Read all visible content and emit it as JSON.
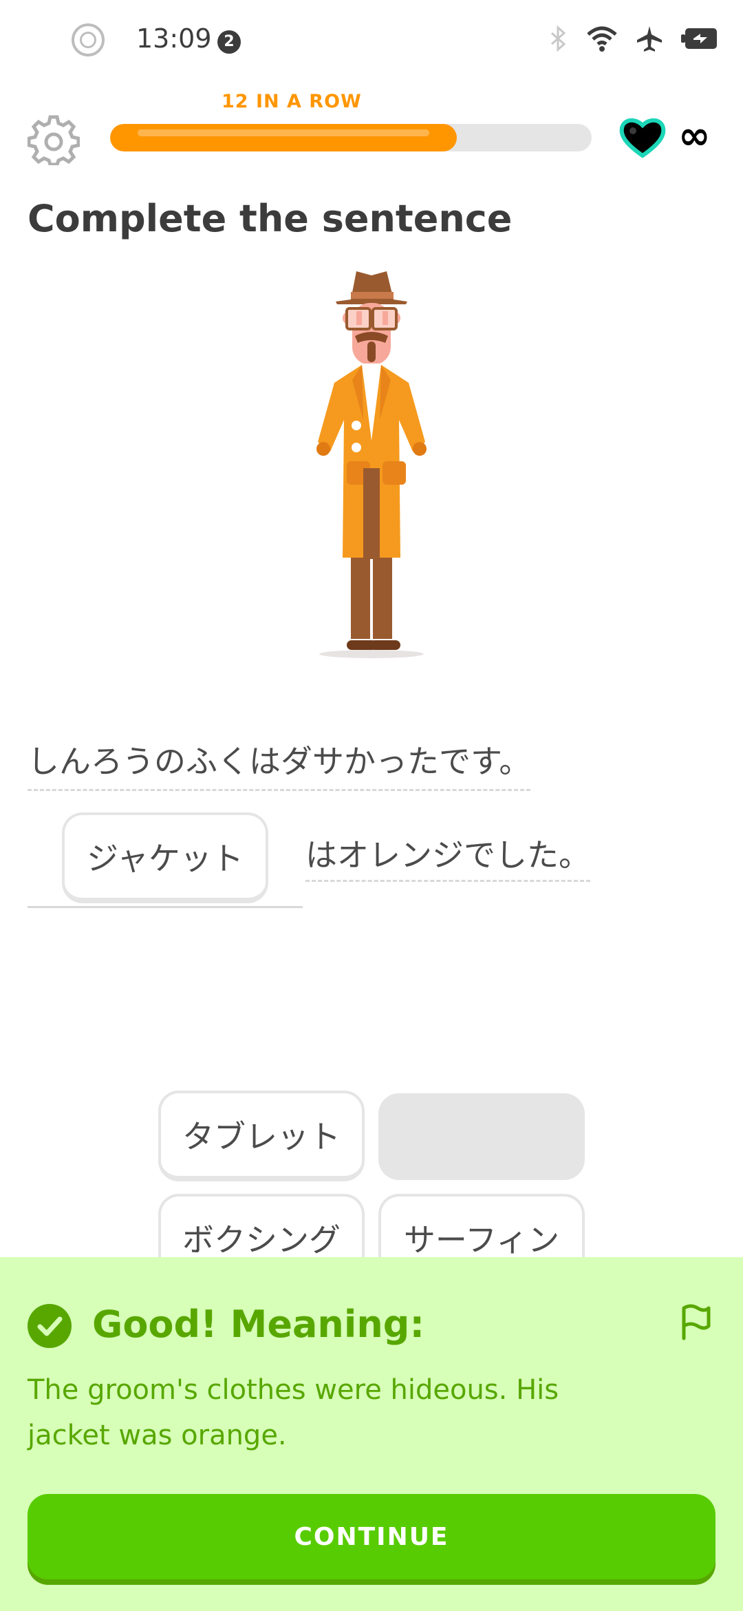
{
  "status_bar": {
    "time": "13:09",
    "notification_count": "2",
    "icons": [
      "record-icon",
      "bluetooth-icon",
      "wifi-icon",
      "airplane-icon",
      "battery-icon"
    ]
  },
  "header": {
    "streak_label": "12 IN A ROW",
    "progress": 0.72,
    "hearts": "∞"
  },
  "prompt": {
    "title": "Complete the sentence"
  },
  "exercise": {
    "sentence1": "しんろうのふくはダサかったです。",
    "answer": "ジャケット",
    "sentence2_rest": "はオレンジでした。"
  },
  "word_bank": [
    {
      "label": "タブレット",
      "used": false
    },
    {
      "label": "",
      "used": true
    },
    {
      "label": "ボクシング",
      "used": false
    },
    {
      "label": "サーフィン",
      "used": false
    }
  ],
  "feedback": {
    "title": "Good! Meaning:",
    "text": "The groom's clothes were hideous. His jacket was orange.",
    "continue_label": "CONTINUE"
  },
  "colors": {
    "accent_orange": "#ff9600",
    "success_green": "#58cc02",
    "feedback_bg": "#d7ffb8"
  }
}
